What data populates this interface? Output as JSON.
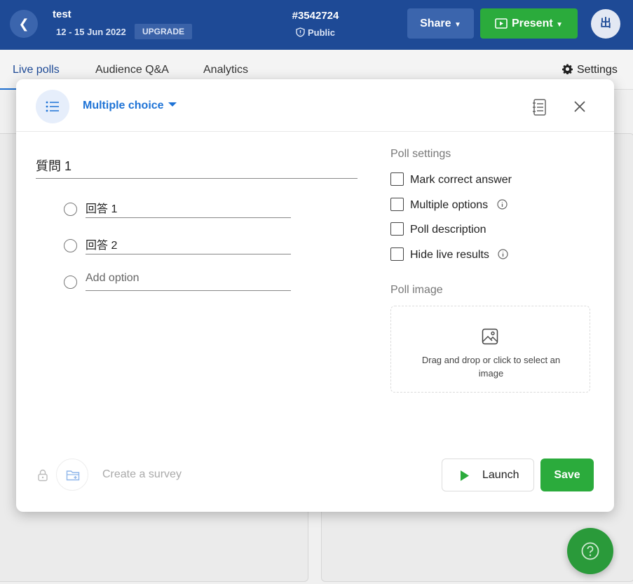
{
  "event": {
    "title": "test",
    "dates": "12 - 15 Jun 2022",
    "upgrade_label": "UPGRADE",
    "code": "#3542724",
    "visibility": "Public"
  },
  "header": {
    "share_label": "Share",
    "present_label": "Present",
    "avatar_initial": "出"
  },
  "tabs": [
    {
      "label": "Live polls",
      "active": true
    },
    {
      "label": "Audience Q&A",
      "active": false
    },
    {
      "label": "Analytics",
      "active": false
    }
  ],
  "settings_label": "Settings",
  "modal": {
    "poll_type": "Multiple choice",
    "question": "質問 1",
    "options": [
      {
        "text": "回答 1"
      },
      {
        "text": "回答 2"
      }
    ],
    "add_option_placeholder": "Add option",
    "poll_settings_label": "Poll settings",
    "settings": [
      {
        "label": "Mark correct answer",
        "checked": false,
        "info": false
      },
      {
        "label": "Multiple options",
        "checked": false,
        "info": true
      },
      {
        "label": "Poll description",
        "checked": false,
        "info": false
      },
      {
        "label": "Hide live results",
        "checked": false,
        "info": true
      }
    ],
    "poll_image_label": "Poll image",
    "dropzone_text": "Drag and drop or click to select an image",
    "create_survey_label": "Create a survey",
    "launch_label": "Launch",
    "save_label": "Save"
  },
  "colors": {
    "header_bg": "#1e4a96",
    "accent_blue": "#1e73d6",
    "primary_green": "#2bab3c"
  }
}
